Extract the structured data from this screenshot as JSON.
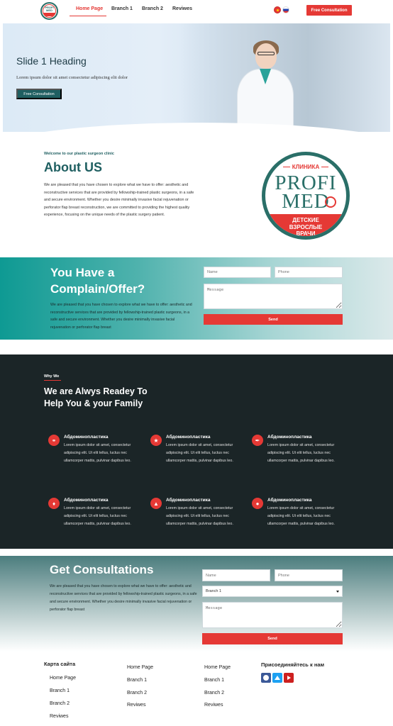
{
  "header": {
    "logo": {
      "line1": "PROFI",
      "line2": "MED"
    },
    "nav": [
      "Home Page",
      "Branch 1",
      "Branch 2",
      "Reviwes"
    ],
    "cta": "Free Consultation",
    "languages": [
      "kg-flag-icon",
      "ru-flag-icon"
    ]
  },
  "hero": {
    "heading": "Slide 1 Heading",
    "text": "Lorem ipsum dolor sit amet consectetur adipiscing elit dolor",
    "button": "Free Consultation"
  },
  "about": {
    "kicker": "Welcome to our plastic surgeon clinic",
    "title": "About US",
    "text": "We are pleased that you have chosen to explore what we have to offer: aesthetic and reconstructive services that are provided by fellowship-trained plastic surgeons, in a safe and secure environment. Whether you desire minimally invasive facial rejuvenation or perforator flap breast reconstruction, we are committed to providing the highest quality experience, focusing on the unique needs of the plastic surgery patient.",
    "logo": {
      "top": "КЛИНИКА",
      "line1": "PROFI",
      "line2": "MED",
      "band": [
        "ДЕТСКИЕ",
        "ВЗРОСЛЫЕ",
        "ВРАЧИ"
      ]
    }
  },
  "complain": {
    "title_line1": "You Have a",
    "title_line2": "Complain/Offer?",
    "text": "We are pleased that you have chosen to explore what we have to offer: aesthetic and reconstructive services that are provided by fellowship-trained plastic surgeons, in a safe and secure environment. Whether you desire minimally invasive facial rejuvenation or perforator flap breast",
    "name_placeholder": "Name",
    "phone_placeholder": "Phone",
    "message_placeholder": "Message",
    "send": "Send"
  },
  "why": {
    "kicker": "Why We",
    "title_line1": "We are Alwys Readey To",
    "title_line2": "Help You & your Family",
    "features": [
      {
        "icon": "stethoscope-icon",
        "title": "Абдоминопластика",
        "text": "Lorem ipsum dolor sit amet, consectetur adipiscing elit. Ut elit tellus, luctus nec ullamcorper mattis, pulvinar dapibus leo."
      },
      {
        "icon": "star-icon",
        "title": "Абдоминопластика",
        "text": "Lorem ipsum dolor sit amet, consectetur adipiscing elit. Ut elit tellus, luctus nec ullamcorper mattis, pulvinar dapibus leo."
      },
      {
        "icon": "syringe-icon",
        "title": "Абдоминопластика",
        "text": "Lorem ipsum dolor sit amet, consectetur adipiscing elit. Ut elit tellus, luctus nec ullamcorper mattis, pulvinar dapibus leo."
      },
      {
        "icon": "tooth-icon",
        "title": "Абдоминопластика",
        "text": "Lorem ipsum dolor sit amet, consectetur adipiscing elit. Ut elit tellus, luctus nec ullamcorper mattis, pulvinar dapibus leo."
      },
      {
        "icon": "bell-icon",
        "title": "Абдоминопластика",
        "text": "Lorem ipsum dolor sit amet, consectetur adipiscing elit. Ut elit tellus, luctus nec ullamcorper mattis, pulvinar dapibus leo."
      },
      {
        "icon": "lightbulb-icon",
        "title": "Абдоминопластика",
        "text": "Lorem ipsum dolor sit amet, consectetur adipiscing elit. Ut elit tellus, luctus nec ullamcorper mattis, pulvinar dapibus leo."
      }
    ]
  },
  "consult": {
    "title": "Get Consultations",
    "text": "We are pleased that you have chosen to explore what we have to offer: aesthetic and reconstructive services that are provided by fellowship-trained plastic surgeons, in a safe and secure environment. Whether you desire minimally invasive facial rejuvenation or perforator flap breast",
    "name_placeholder": "Name",
    "phone_placeholder": "Phone",
    "branch_selected": "Branch 1",
    "message_placeholder": "Message",
    "send": "Send"
  },
  "footer": {
    "sitemap_title": "Карта сайта",
    "col1": [
      "Home Page",
      "Branch 1",
      "Branch 2",
      "Reviwes"
    ],
    "col2": [
      "Home Page",
      "Branch 1",
      "Branch 2",
      "Reviwes"
    ],
    "col3": [
      "Home Page",
      "Branch 1",
      "Branch 2",
      "Reviwes"
    ],
    "social_title": "Присоединяйтесь к нам",
    "social": [
      {
        "icon": "facebook-icon",
        "color": "#3b5998"
      },
      {
        "icon": "twitter-icon",
        "color": "#1da1f2"
      },
      {
        "icon": "youtube-icon",
        "color": "#cd201f"
      }
    ]
  },
  "colors": {
    "accent": "#e53935",
    "teal": "#1f5f61",
    "dark": "#1b2527"
  }
}
